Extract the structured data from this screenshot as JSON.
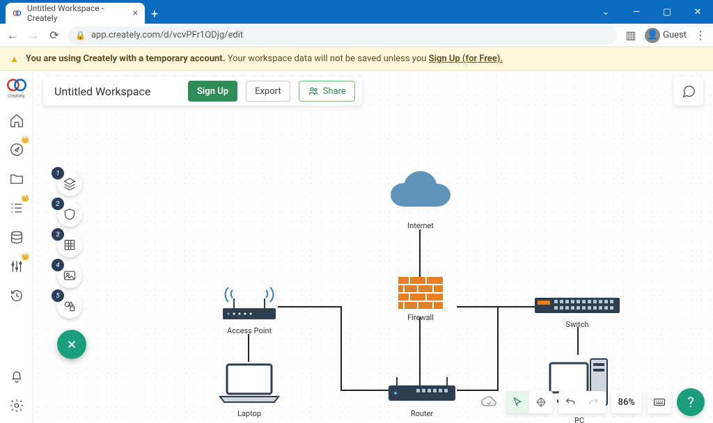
{
  "browser": {
    "tab_title": "Untitled Workspace - Creately",
    "url": "app.creately.com/d/vcvPFr1ODjg/edit",
    "guest_label": "Guest"
  },
  "banner": {
    "prefix_bold": "You are using Creately with a temporary account.",
    "middle": " Your workspace data will not be saved unless you ",
    "link": "Sign Up (for Free).",
    "warn_icon": "warning-icon"
  },
  "topbar": {
    "workspace_name": "Untitled Workspace",
    "signup": "Sign Up",
    "export": "Export",
    "share": "Share",
    "share_icon": "people-icon"
  },
  "sidebar": {
    "items": [
      {
        "name": "home-icon"
      },
      {
        "name": "compass-icon",
        "crown": true
      },
      {
        "name": "folder-icon"
      },
      {
        "name": "list-icon",
        "crown": true
      },
      {
        "name": "database-icon"
      },
      {
        "name": "sliders-icon",
        "crown": true
      },
      {
        "name": "history-icon"
      }
    ],
    "bottom": [
      {
        "name": "bell-icon"
      },
      {
        "name": "gear-icon"
      }
    ]
  },
  "floattools": {
    "items": [
      {
        "badge": "1",
        "name": "layers-icon"
      },
      {
        "badge": "2",
        "name": "shield-icon"
      },
      {
        "badge": "3",
        "name": "grid-icon"
      },
      {
        "badge": "4",
        "name": "image-icon"
      },
      {
        "badge": "5",
        "name": "shapes-icon"
      }
    ],
    "close_icon": "close-icon"
  },
  "diagram": {
    "internet": "Internet",
    "firewall": "Firewall",
    "access_point": "Access Point",
    "laptop": "Laptop",
    "router": "Router",
    "switch": "Switch",
    "pc": "PC"
  },
  "bottombar": {
    "zoom": "86%",
    "sync_icon": "cloud-sync-icon",
    "pointer_icon": "pointer-icon",
    "pan_icon": "pan-icon",
    "undo_icon": "undo-icon",
    "redo_icon": "redo-icon",
    "keyboard_icon": "keyboard-icon",
    "help_icon": "help-icon"
  },
  "comment_icon": "comment-icon"
}
